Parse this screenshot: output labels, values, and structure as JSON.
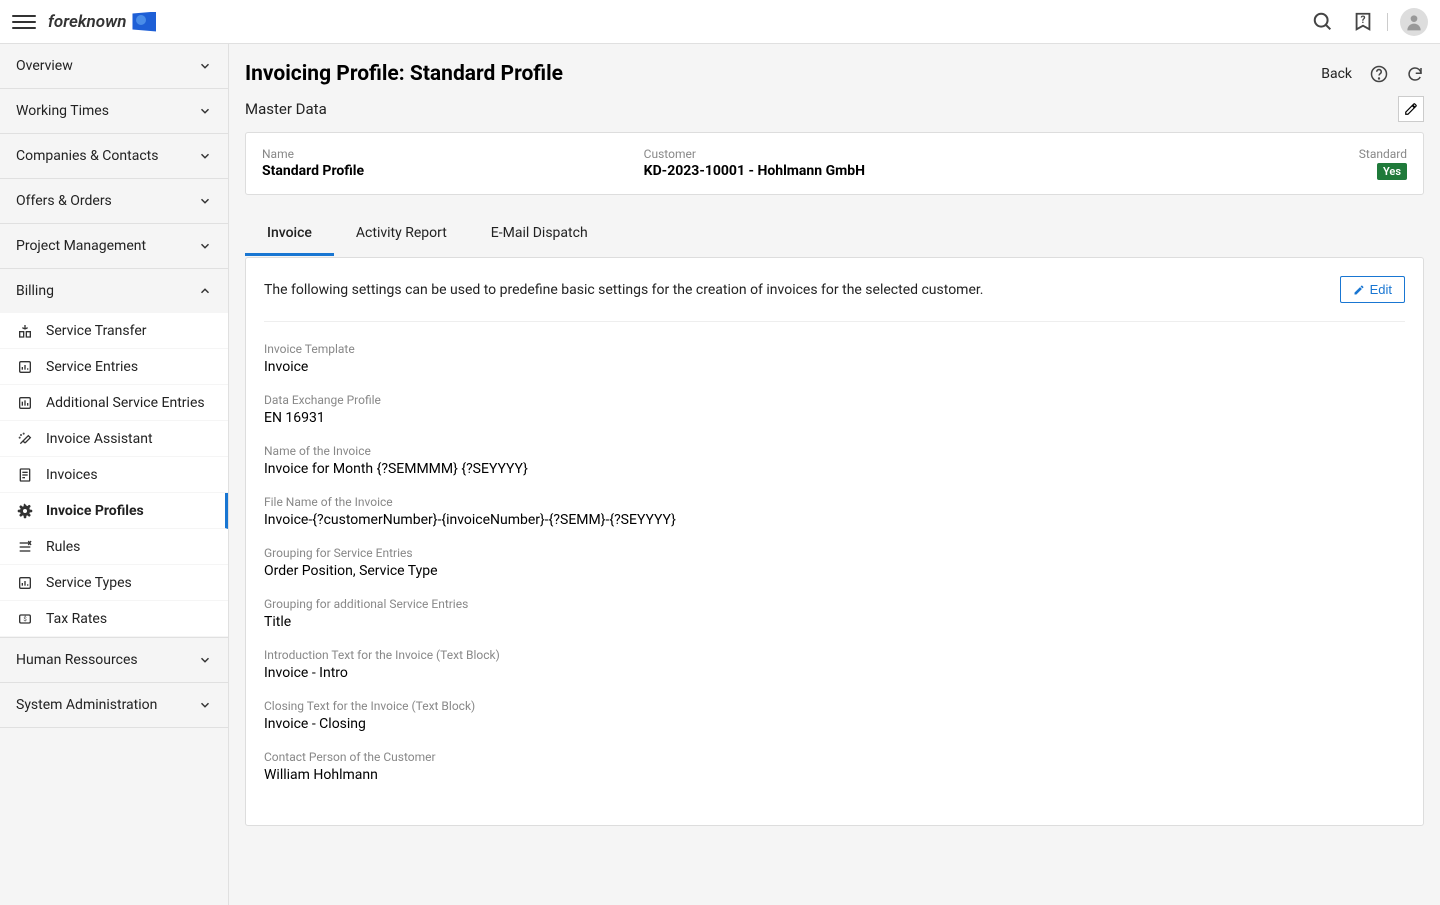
{
  "brand": "foreknown",
  "header": {
    "back": "Back"
  },
  "sidebar": {
    "sections": [
      {
        "label": "Overview",
        "expanded": false
      },
      {
        "label": "Working Times",
        "expanded": false
      },
      {
        "label": "Companies & Contacts",
        "expanded": false
      },
      {
        "label": "Offers & Orders",
        "expanded": false
      },
      {
        "label": "Project Management",
        "expanded": false
      },
      {
        "label": "Billing",
        "expanded": true,
        "items": [
          {
            "label": "Service Transfer"
          },
          {
            "label": "Service Entries"
          },
          {
            "label": "Additional Service Entries"
          },
          {
            "label": "Invoice Assistant"
          },
          {
            "label": "Invoices"
          },
          {
            "label": "Invoice Profiles",
            "active": true
          },
          {
            "label": "Rules"
          },
          {
            "label": "Service Types"
          },
          {
            "label": "Tax Rates"
          }
        ]
      },
      {
        "label": "Human Ressources",
        "expanded": false
      },
      {
        "label": "System Administration",
        "expanded": false
      }
    ]
  },
  "page": {
    "title": "Invoicing Profile: Standard Profile",
    "section": "Master Data",
    "master": {
      "name_label": "Name",
      "name_value": "Standard Profile",
      "customer_label": "Customer",
      "customer_value": "KD-2023-10001 - Hohlmann GmbH",
      "standard_label": "Standard",
      "standard_badge": "Yes"
    },
    "tabs": [
      {
        "label": "Invoice",
        "active": true
      },
      {
        "label": "Activity Report"
      },
      {
        "label": "E-Mail Dispatch"
      }
    ],
    "content": {
      "intro": "The following settings can be used to predefine basic settings for the creation of invoices for the selected customer.",
      "edit_label": "Edit",
      "fields": [
        {
          "label": "Invoice Template",
          "value": "Invoice"
        },
        {
          "label": "Data Exchange Profile",
          "value": "EN 16931"
        },
        {
          "label": "Name of the Invoice",
          "value": "Invoice for Month {?SEMMMM} {?SEYYYY}"
        },
        {
          "label": "File Name of the Invoice",
          "value": "Invoice-{?customerNumber}-{invoiceNumber}-{?SEMM}-{?SEYYYY}"
        },
        {
          "label": "Grouping for Service Entries",
          "value": "Order Position, Service Type"
        },
        {
          "label": "Grouping for additional Service Entries",
          "value": "Title"
        },
        {
          "label": "Introduction Text for the Invoice (Text Block)",
          "value": "Invoice - Intro"
        },
        {
          "label": "Closing Text for the Invoice (Text Block)",
          "value": "Invoice - Closing"
        },
        {
          "label": "Contact Person of the Customer",
          "value": "William Hohlmann"
        }
      ]
    }
  }
}
